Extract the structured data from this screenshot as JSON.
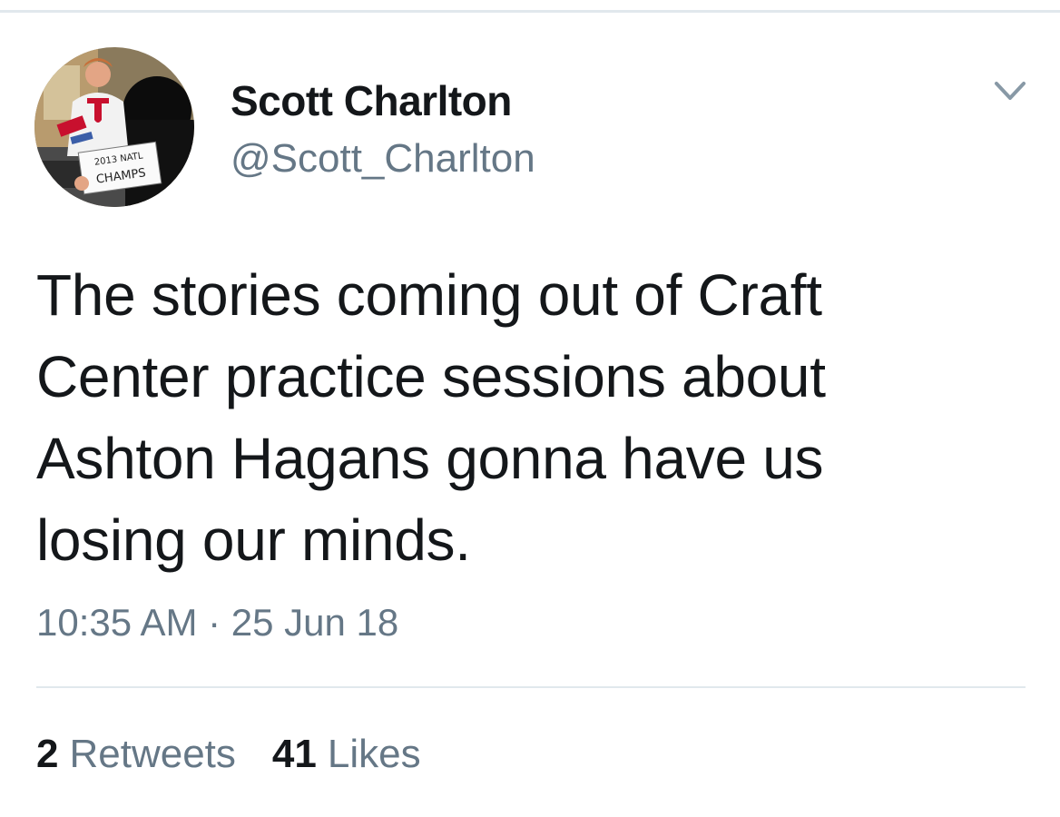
{
  "tweet": {
    "author": {
      "display_name": "Scott Charlton",
      "handle": "@Scott_Charlton",
      "avatar_sign": {
        "line1": "2013 NATL",
        "line2": "CHAMPS"
      }
    },
    "text_lines": [
      "The stories coming out of Craft",
      "Center practice sessions about",
      "Ashton Hagans gonna have us",
      "losing our minds."
    ],
    "timestamp": "10:35 AM · 25 Jun 18",
    "stats": {
      "retweets_count": "2",
      "retweets_label": "Retweets",
      "likes_count": "41",
      "likes_label": "Likes"
    }
  },
  "icons": {
    "menu": "chevron-down-icon"
  },
  "colors": {
    "text_primary": "#14171a",
    "text_secondary": "#657786",
    "divider": "#e1e8ed",
    "avatar_logo": "#c8102e"
  }
}
